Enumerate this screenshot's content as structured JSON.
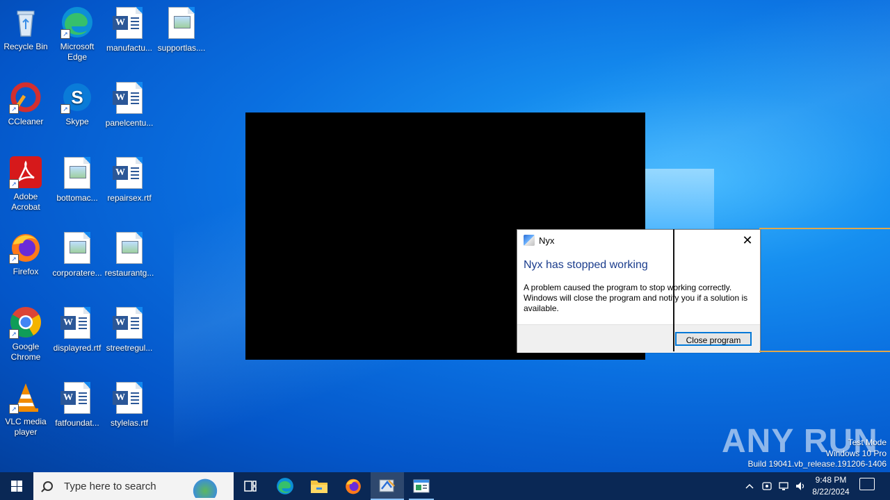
{
  "desktop": {
    "icons": [
      {
        "label": "Recycle Bin",
        "kind": "recycle-bin"
      },
      {
        "label": "Microsoft Edge",
        "kind": "edge"
      },
      {
        "label": "manufactu...",
        "kind": "word-doc"
      },
      {
        "label": "supportlas....",
        "kind": "image-doc"
      },
      {
        "label": "CCleaner",
        "kind": "ccleaner"
      },
      {
        "label": "Skype",
        "kind": "skype"
      },
      {
        "label": "panelcentu...",
        "kind": "word-doc"
      },
      {
        "label": "Adobe Acrobat",
        "kind": "acrobat"
      },
      {
        "label": "bottomac...",
        "kind": "image-doc"
      },
      {
        "label": "repairsex.rtf",
        "kind": "word-doc"
      },
      {
        "label": "Firefox",
        "kind": "firefox"
      },
      {
        "label": "corporatere...",
        "kind": "image-doc"
      },
      {
        "label": "restaurantg...",
        "kind": "image-doc"
      },
      {
        "label": "Google Chrome",
        "kind": "chrome"
      },
      {
        "label": "displayred.rtf",
        "kind": "word-doc"
      },
      {
        "label": "streetregul...",
        "kind": "word-doc"
      },
      {
        "label": "VLC media player",
        "kind": "vlc"
      },
      {
        "label": "fatfoundat...",
        "kind": "word-doc"
      },
      {
        "label": "stylelas.rtf",
        "kind": "word-doc"
      }
    ]
  },
  "dialog": {
    "app_name": "Nyx",
    "heading": "Nyx has stopped working",
    "body": "A problem caused the program to stop working correctly. Windows will close the program and notify you if a solution is available.",
    "close_glyph": "✕",
    "button_label": "Close program"
  },
  "watermark": {
    "brand": "ANY RUN",
    "line1": "Test Mode",
    "line2": "Windows 10 Pro",
    "line3": "Build 19041.vb_release.191206-1406"
  },
  "taskbar": {
    "search_placeholder": "Type here to search",
    "pinned": [
      "task-view",
      "edge",
      "file-explorer",
      "firefox",
      "nyx-app",
      "notepad-app"
    ],
    "active_app": "nyx-app",
    "clock_time": "9:48 PM",
    "clock_date": "8/22/2024",
    "tray_icons": [
      "chevron-up-icon",
      "meet-now-icon",
      "network-icon",
      "volume-icon"
    ]
  },
  "colors": {
    "dialog_heading": "#1a3c8c",
    "button_border": "#0078d7",
    "taskbar": "#0a2855"
  }
}
